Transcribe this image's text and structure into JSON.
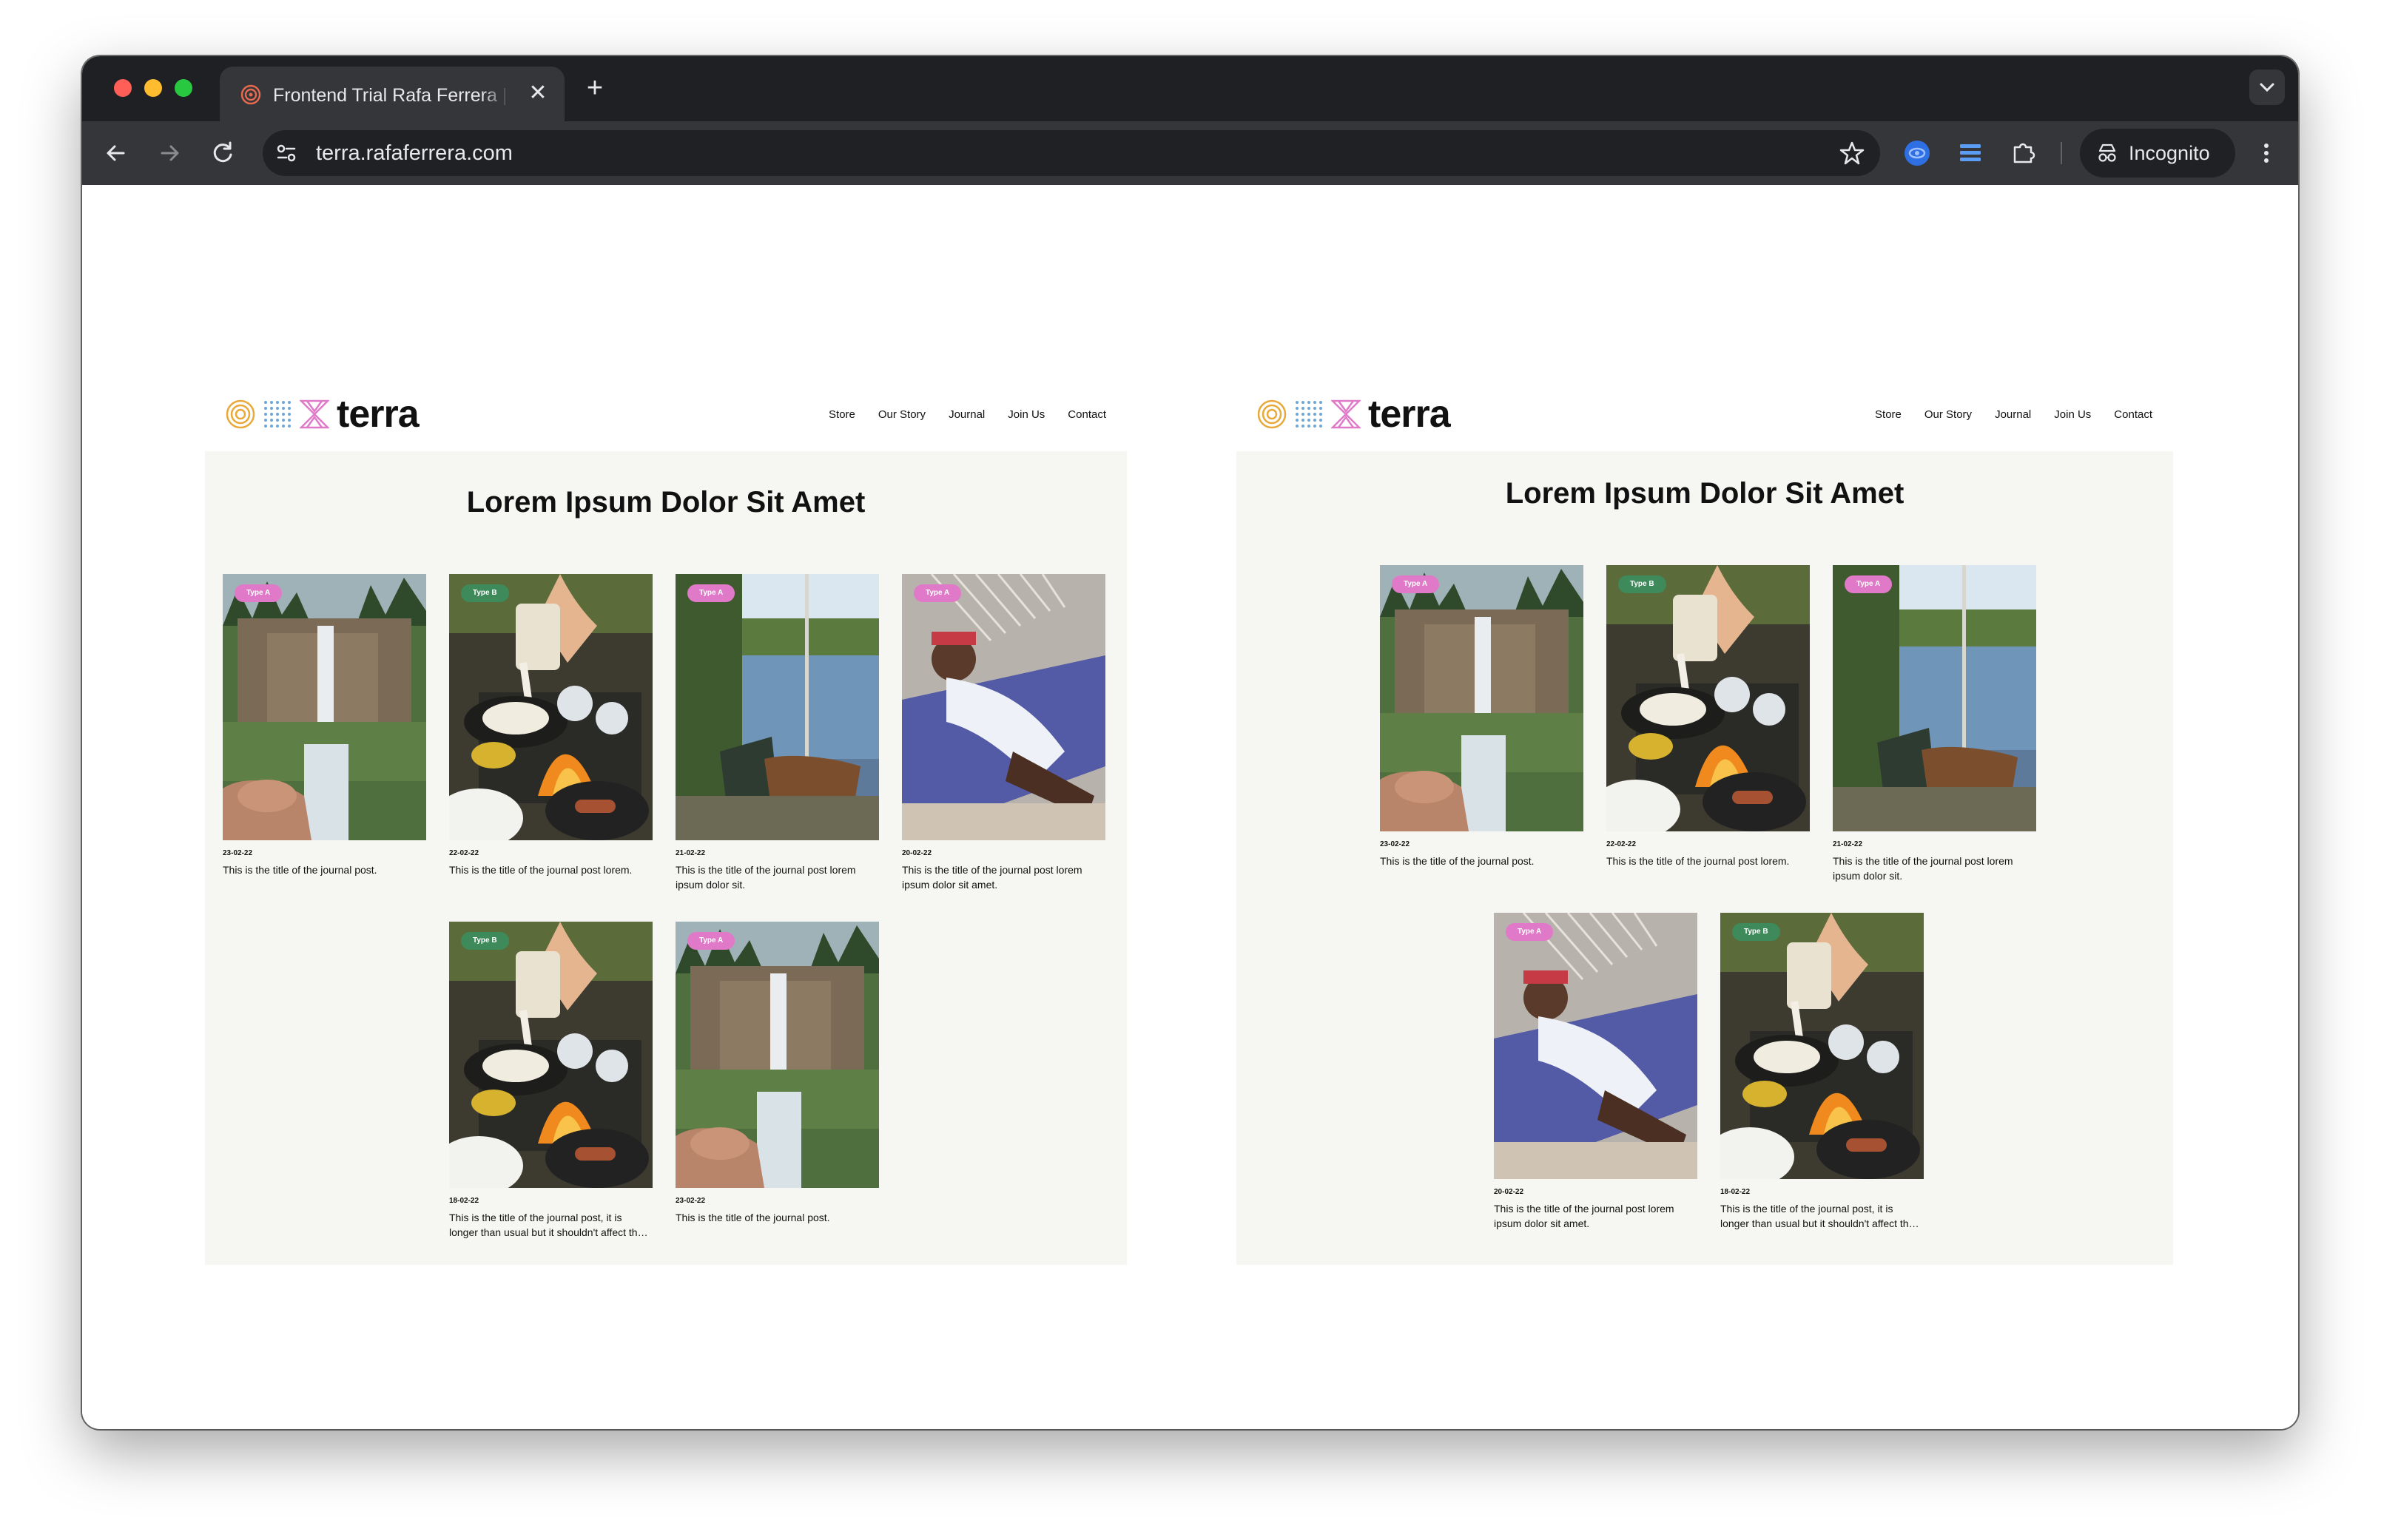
{
  "browser": {
    "tab_title": "Frontend Trial Rafa Ferrera | Terra",
    "url": "terra.rafaferrera.com",
    "incognito_label": "Incognito",
    "new_tab_label": "+",
    "close_label": "✕"
  },
  "brand": {
    "name": "terra",
    "colors": {
      "yellow": "#e8a93a",
      "blue": "#6ea6d8",
      "pink": "#e07ac8",
      "green": "#3f8a5b",
      "panel": "#f6f6f2"
    }
  },
  "nav": [
    "Store",
    "Our Story",
    "Journal",
    "Join Us",
    "Contact"
  ],
  "page": {
    "title": "Lorem Ipsum Dolor Sit Amet"
  },
  "badges": {
    "a": "Type A",
    "b": "Type B"
  },
  "left": {
    "posts": [
      {
        "badge": "Type A",
        "date": "23-02-22",
        "title": "This is the title of the journal post.",
        "image": "waterfall"
      },
      {
        "badge": "Type B",
        "date": "22-02-22",
        "title": "This is the title of the journal post lorem.",
        "image": "campfire"
      },
      {
        "badge": "Type A",
        "date": "21-02-22",
        "title": "This is the title of the journal post lorem ipsum dolor sit.",
        "image": "boat"
      },
      {
        "badge": "Type A",
        "date": "20-02-22",
        "title": "This is the title of the journal post lorem ipsum dolor sit amet.",
        "image": "hammock"
      },
      {
        "badge": "Type B",
        "date": "18-02-22",
        "title": "This is the title of the journal post, it is longer than usual but it shouldn't affect the layout.",
        "image": "campfire"
      },
      {
        "badge": "Type A",
        "date": "23-02-22",
        "title": "This is the title of the journal post.",
        "image": "waterfall"
      }
    ]
  },
  "right": {
    "posts": [
      {
        "badge": "Type A",
        "date": "23-02-22",
        "title": "This is the title of the journal post.",
        "image": "waterfall"
      },
      {
        "badge": "Type B",
        "date": "22-02-22",
        "title": "This is the title of the journal post lorem.",
        "image": "campfire"
      },
      {
        "badge": "Type A",
        "date": "21-02-22",
        "title": "This is the title of the journal post lorem ipsum dolor sit.",
        "image": "boat"
      },
      {
        "badge": "Type A",
        "date": "20-02-22",
        "title": "This is the title of the journal post lorem ipsum dolor sit amet.",
        "image": "hammock"
      },
      {
        "badge": "Type B",
        "date": "18-02-22",
        "title": "This is the title of the journal post, it is longer than usual but it shouldn't affect the layout.",
        "image": "campfire"
      }
    ]
  }
}
